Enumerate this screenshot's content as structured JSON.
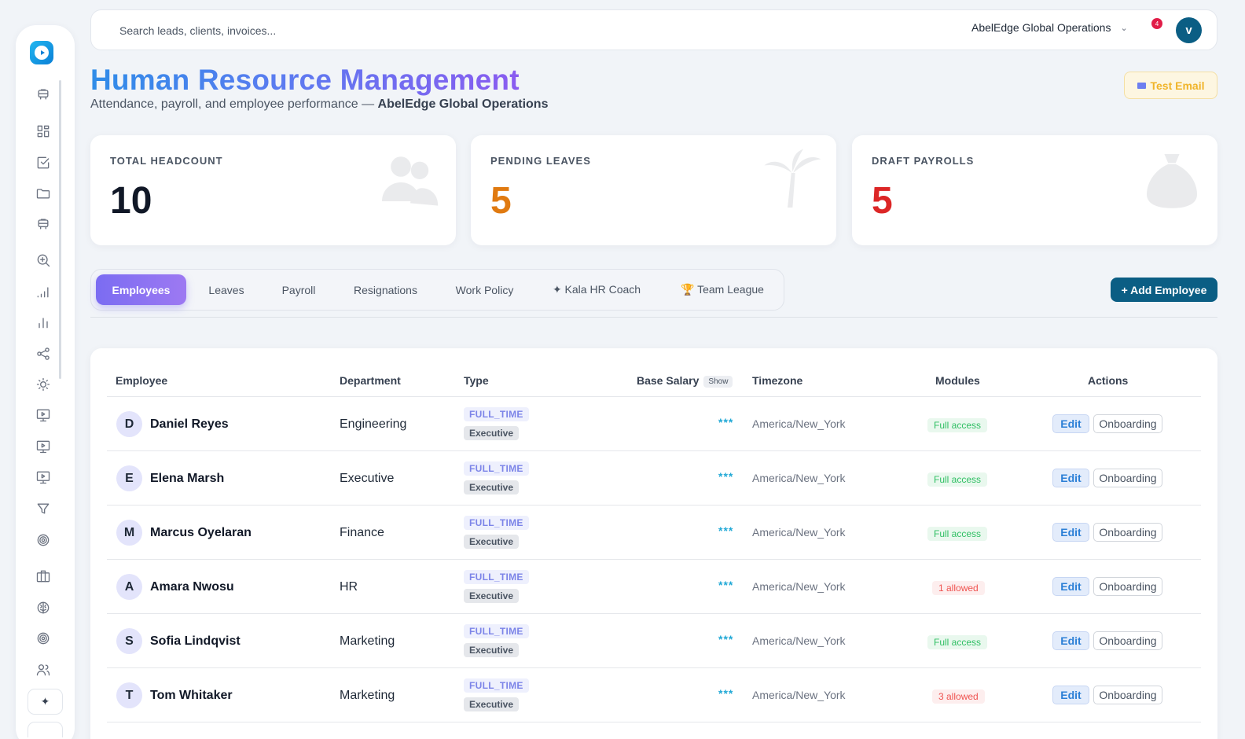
{
  "search": {
    "placeholder": "Search leads, clients, invoices..."
  },
  "header": {
    "org_name": "AbelEdge Global Operations",
    "notification_count": "4",
    "user_initial": "v"
  },
  "page": {
    "title": "Human Resource Management",
    "subtitle_prefix": "Attendance, payroll, and employee performance — ",
    "subtitle_org": "AbelEdge Global Operations",
    "test_email_label": "Test Email"
  },
  "stats": [
    {
      "label": "TOTAL HEADCOUNT",
      "value": "10",
      "color": "#111827"
    },
    {
      "label": "PENDING LEAVES",
      "value": "5",
      "color": "#e07a10"
    },
    {
      "label": "DRAFT PAYROLLS",
      "value": "5",
      "color": "#dc2626"
    }
  ],
  "tabs": [
    {
      "label": "Employees",
      "active": true
    },
    {
      "label": "Leaves"
    },
    {
      "label": "Payroll"
    },
    {
      "label": "Resignations"
    },
    {
      "label": "Work Policy"
    },
    {
      "label": "✦ Kala HR Coach"
    },
    {
      "label": "🏆 Team League"
    }
  ],
  "add_employee_label": "+ Add Employee",
  "table": {
    "columns": {
      "employee": "Employee",
      "department": "Department",
      "type": "Type",
      "base_salary": "Base Salary",
      "show": "Show",
      "timezone": "Timezone",
      "modules": "Modules",
      "actions": "Actions"
    },
    "edit_label": "Edit",
    "onboarding_label": "Onboarding",
    "rows": [
      {
        "initial": "D",
        "name": "Daniel Reyes",
        "department": "Engineering",
        "type": "FULL_TIME",
        "level": "Executive",
        "salary": "***",
        "timezone": "America/New_York",
        "modules": "Full access",
        "modules_status": "full"
      },
      {
        "initial": "E",
        "name": "Elena Marsh",
        "department": "Executive",
        "type": "FULL_TIME",
        "level": "Executive",
        "salary": "***",
        "timezone": "America/New_York",
        "modules": "Full access",
        "modules_status": "full"
      },
      {
        "initial": "M",
        "name": "Marcus Oyelaran",
        "department": "Finance",
        "type": "FULL_TIME",
        "level": "Executive",
        "salary": "***",
        "timezone": "America/New_York",
        "modules": "Full access",
        "modules_status": "full"
      },
      {
        "initial": "A",
        "name": "Amara Nwosu",
        "department": "HR",
        "type": "FULL_TIME",
        "level": "Executive",
        "salary": "***",
        "timezone": "America/New_York",
        "modules": "1 allowed",
        "modules_status": "limited"
      },
      {
        "initial": "S",
        "name": "Sofia Lindqvist",
        "department": "Marketing",
        "type": "FULL_TIME",
        "level": "Executive",
        "salary": "***",
        "timezone": "America/New_York",
        "modules": "Full access",
        "modules_status": "full"
      },
      {
        "initial": "T",
        "name": "Tom Whitaker",
        "department": "Marketing",
        "type": "FULL_TIME",
        "level": "Executive",
        "salary": "***",
        "timezone": "America/New_York",
        "modules": "3 allowed",
        "modules_status": "limited"
      }
    ]
  },
  "sidebar": {
    "icons": [
      "bus-icon",
      "grid-icon",
      "checkbox-icon",
      "folder-icon",
      "bus-icon",
      "search-zoom-icon",
      "signal-bars-icon",
      "bar-chart-icon",
      "share-icon",
      "sun-icon",
      "monitor-play-icon",
      "monitor-play-icon",
      "monitor-play-icon",
      "filter-icon",
      "target-icon",
      "briefcase-icon",
      "brain-icon",
      "target-icon",
      "users-icon"
    ],
    "sparkle_label": "✦"
  }
}
